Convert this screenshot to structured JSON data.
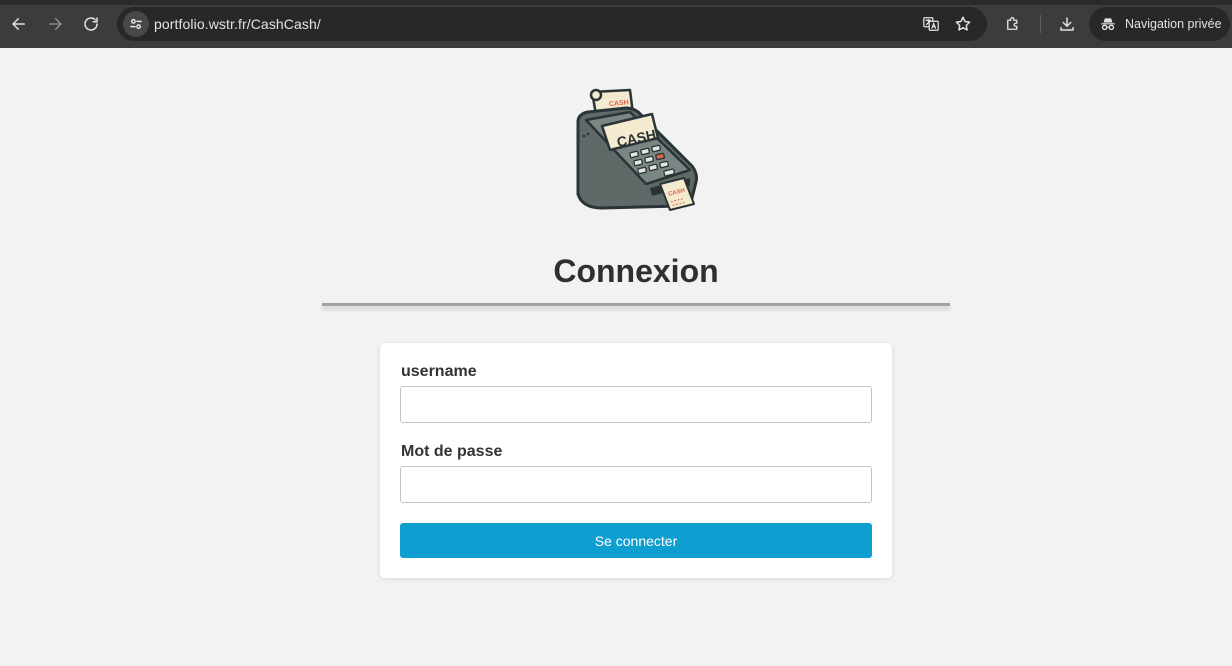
{
  "browser": {
    "url": "portfolio.wstr.fr/CashCash/",
    "profile_label": "Navigation privée",
    "icons": {
      "back": "arrow-left-icon",
      "forward": "arrow-right-icon",
      "reload": "reload-icon",
      "site_info": "tune-icon",
      "translate": "translate-icon",
      "bookmark": "star-icon",
      "extensions": "puzzle-icon",
      "downloads": "download-icon",
      "incognito": "incognito-icon"
    }
  },
  "page": {
    "logo": {
      "label": "CASH",
      "receipt_text": "CASH",
      "colors": {
        "body": "#5f6a68",
        "screen": "#f4ead0",
        "accent": "#d8634a",
        "outline": "#2a3436"
      }
    },
    "title": "Connexion",
    "form": {
      "username": {
        "label": "username",
        "value": "",
        "placeholder": ""
      },
      "password": {
        "label": "Mot de passe",
        "value": "",
        "placeholder": ""
      },
      "submit_label": "Se connecter"
    }
  },
  "colors": {
    "accent": "#0e9ecf",
    "page_bg": "#f2f2f2",
    "chrome_bg": "#3c3c3c"
  }
}
